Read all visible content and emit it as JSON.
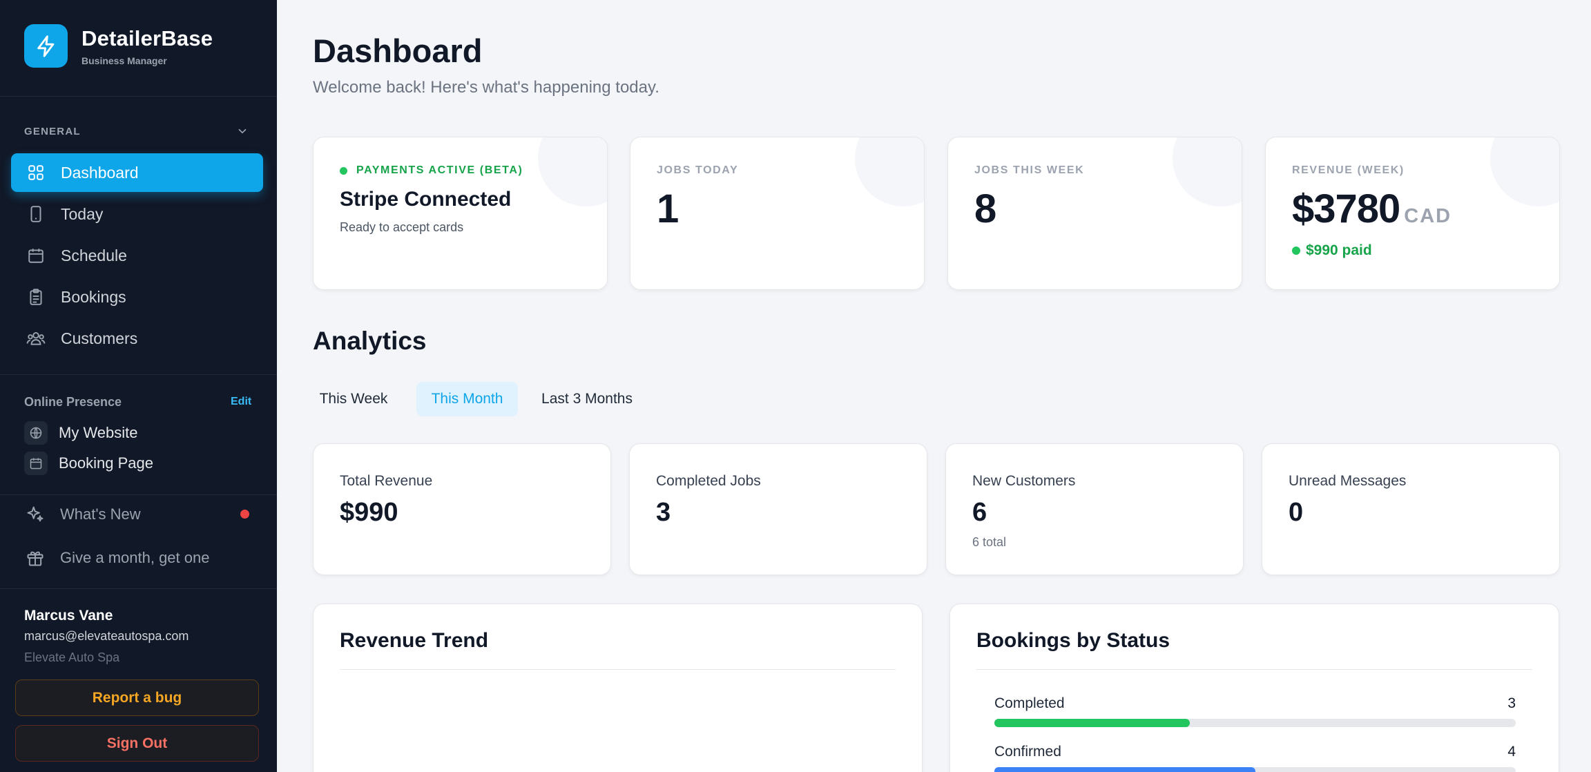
{
  "brand": {
    "name": "DetailerBase",
    "subtitle": "Business Manager"
  },
  "sidebar": {
    "section_label": "GENERAL",
    "nav": [
      {
        "label": "Dashboard",
        "icon": "grid-icon",
        "active": true
      },
      {
        "label": "Today",
        "icon": "phone-icon",
        "active": false
      },
      {
        "label": "Schedule",
        "icon": "calendar-icon",
        "active": false
      },
      {
        "label": "Bookings",
        "icon": "clipboard-icon",
        "active": false
      },
      {
        "label": "Customers",
        "icon": "users-icon",
        "active": false
      }
    ],
    "online_presence": {
      "label": "Online Presence",
      "edit_label": "Edit",
      "items": [
        {
          "label": "My Website",
          "icon": "globe-icon"
        },
        {
          "label": "Booking Page",
          "icon": "calendar-icon"
        }
      ]
    },
    "whats_new": "What's New",
    "referral": "Give a month, get one",
    "user": {
      "name": "Marcus Vane",
      "email": "marcus@elevateautospa.com",
      "org": "Elevate Auto Spa"
    },
    "report_bug": "Report a bug",
    "sign_out": "Sign Out"
  },
  "header": {
    "title": "Dashboard",
    "subtitle": "Welcome back! Here's what's happening today."
  },
  "stats": {
    "payments": {
      "label": "PAYMENTS ACTIVE (BETA)",
      "title": "Stripe Connected",
      "subtitle": "Ready to accept cards"
    },
    "jobs_today": {
      "label": "JOBS TODAY",
      "value": "1"
    },
    "jobs_week": {
      "label": "JOBS THIS WEEK",
      "value": "8"
    },
    "revenue_week": {
      "label": "REVENUE (WEEK)",
      "amount": "$3780",
      "currency": "CAD",
      "paid": "$990 paid"
    }
  },
  "analytics": {
    "title": "Analytics",
    "tabs": [
      {
        "label": "This Week",
        "active": false
      },
      {
        "label": "This Month",
        "active": true
      },
      {
        "label": "Last 3 Months",
        "active": false
      }
    ],
    "metrics": [
      {
        "label": "Total Revenue",
        "value": "$990",
        "sub": ""
      },
      {
        "label": "Completed Jobs",
        "value": "3",
        "sub": ""
      },
      {
        "label": "New Customers",
        "value": "6",
        "sub": "6 total"
      },
      {
        "label": "Unread Messages",
        "value": "0",
        "sub": ""
      }
    ]
  },
  "revenue_trend": {
    "title": "Revenue Trend"
  },
  "bookings_by_status": {
    "title": "Bookings by Status",
    "items": [
      {
        "name": "Completed",
        "count": "3",
        "fraction": 0.375,
        "color": "#22c55e"
      },
      {
        "name": "Confirmed",
        "count": "4",
        "fraction": 0.5,
        "color": "#3b82f6"
      }
    ]
  },
  "colors": {
    "accent": "#0ea5e9",
    "sidebar_bg": "#111827",
    "success": "#22c55e",
    "warning": "#f5a623",
    "danger": "#f87164"
  }
}
